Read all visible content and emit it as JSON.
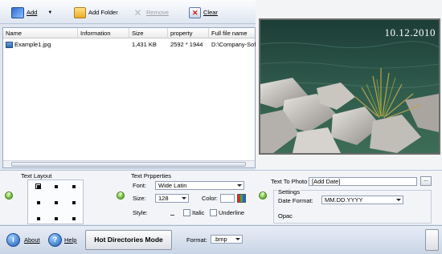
{
  "toolbar": {
    "add_label": "Add",
    "add_folder_label": "Add Folder",
    "remove_label": "Remove",
    "clear_label": "Clear"
  },
  "file_list": {
    "columns": [
      "Name",
      "Information",
      "Size",
      "property",
      "Full file name"
    ],
    "rows": [
      {
        "name": "Example1.jpg",
        "information": "",
        "size": "1,431 KB",
        "property": "2592 * 1944",
        "full_file_name": "D:\\Company-Sof"
      }
    ]
  },
  "preview": {
    "date_stamp": "10.12.2010"
  },
  "text_layout": {
    "title": "Text Layout",
    "selected_position": "top-left"
  },
  "text_properties": {
    "title": "Text Prpperties",
    "font_label": "Font:",
    "font_value": "Wide Latin",
    "size_label": "Size:",
    "size_value": "128",
    "color_label": "Color:",
    "style_label": "Style:",
    "italic_label": "Italic",
    "underline_label": "Underline"
  },
  "text_to_photo": {
    "label": "Text To Photo",
    "value": "[Add Date]",
    "browse_label": "...",
    "settings_title": "Settings",
    "date_format_label": "Date Format:",
    "date_format_value": "MM.DD.YYYY",
    "opacity_label": "Opac"
  },
  "bottom_bar": {
    "about_label": "About",
    "help_label": "Help",
    "hot_directories_label": "Hot Directories Mode",
    "format_label": "Format:",
    "format_value": ".bmp"
  },
  "colors": {
    "accent_blue": "#1f5fb6",
    "help_green": "#4c9d1e",
    "panel_bg": "#dfe6f0"
  }
}
